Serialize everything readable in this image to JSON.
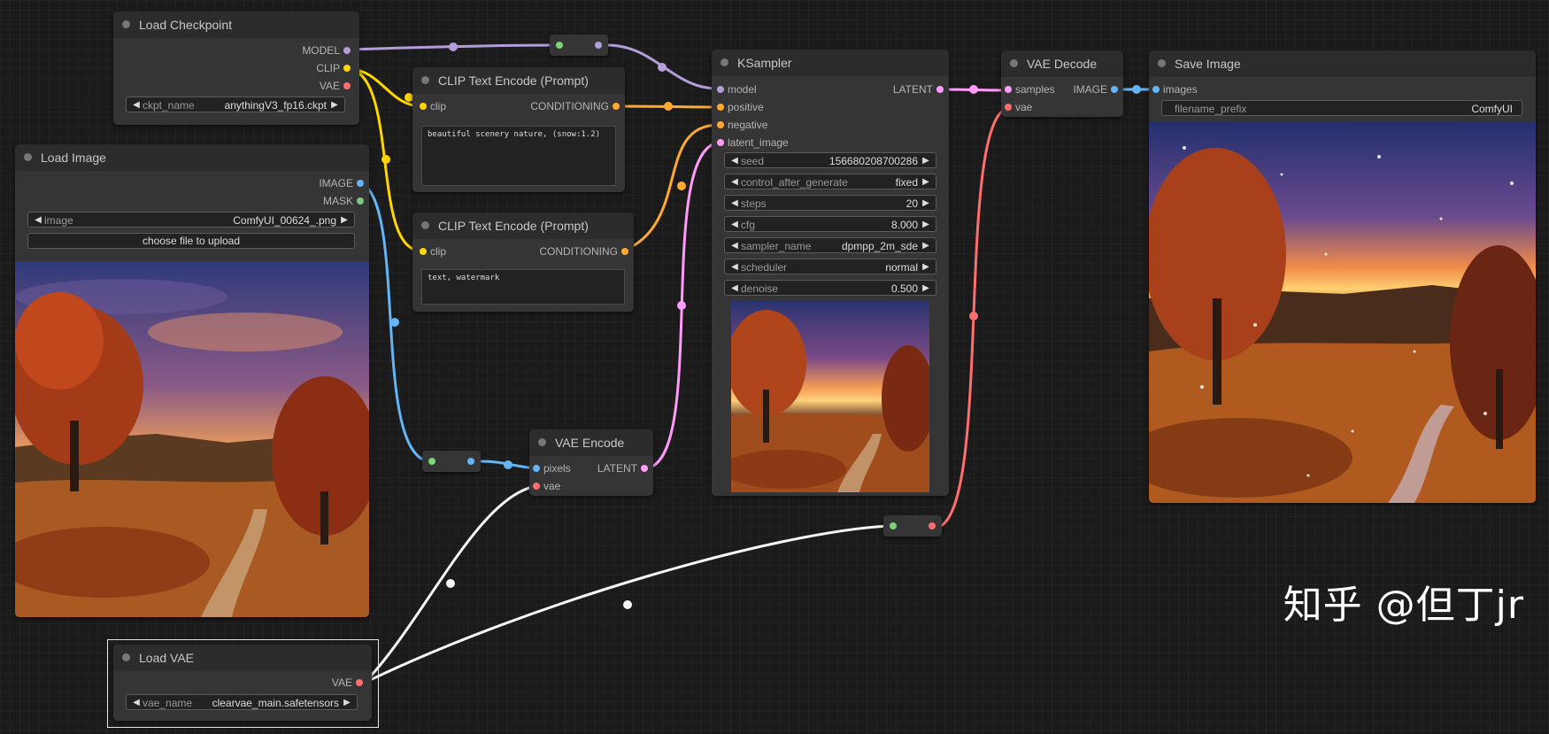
{
  "colors": {
    "model": "#b39ddb",
    "clip": "#ffd500",
    "vae": "#ff6e6e",
    "conditioning": "#ffa931",
    "latent": "#ff9cf9",
    "image": "#64b5f6",
    "mask": "#81c784",
    "vae_link": "#f5f5f5"
  },
  "nodes": {
    "load_checkpoint": {
      "title": "Load Checkpoint",
      "outputs": [
        "MODEL",
        "CLIP",
        "VAE"
      ],
      "widget": {
        "name": "ckpt_name",
        "value": "anythingV3_fp16.ckpt"
      }
    },
    "load_image": {
      "title": "Load Image",
      "outputs": [
        "IMAGE",
        "MASK"
      ],
      "widget": {
        "name": "image",
        "value": "ComfyUI_00624_.png"
      },
      "upload_button": "choose file to upload"
    },
    "clip_pos": {
      "title": "CLIP Text Encode (Prompt)",
      "input": "clip",
      "output": "CONDITIONING",
      "text": "beautiful scenery nature, (snow:1.2)"
    },
    "clip_neg": {
      "title": "CLIP Text Encode (Prompt)",
      "input": "clip",
      "output": "CONDITIONING",
      "text": "text, watermark"
    },
    "ksampler": {
      "title": "KSampler",
      "inputs": [
        "model",
        "positive",
        "negative",
        "latent_image"
      ],
      "output": "LATENT",
      "widgets": [
        {
          "name": "seed",
          "value": "156680208700286"
        },
        {
          "name": "control_after_generate",
          "value": "fixed"
        },
        {
          "name": "steps",
          "value": "20"
        },
        {
          "name": "cfg",
          "value": "8.000"
        },
        {
          "name": "sampler_name",
          "value": "dpmpp_2m_sde"
        },
        {
          "name": "scheduler",
          "value": "normal"
        },
        {
          "name": "denoise",
          "value": "0.500"
        }
      ]
    },
    "vae_decode": {
      "title": "VAE Decode",
      "inputs": [
        "samples",
        "vae"
      ],
      "output": "IMAGE"
    },
    "save_image": {
      "title": "Save Image",
      "input": "images",
      "widget": {
        "name": "filename_prefix",
        "value": "ComfyUI"
      }
    },
    "vae_encode": {
      "title": "VAE Encode",
      "inputs": [
        "pixels",
        "vae"
      ],
      "output": "LATENT"
    },
    "load_vae": {
      "title": "Load VAE",
      "output": "VAE",
      "widget": {
        "name": "vae_name",
        "value": "clearvae_main.safetensors"
      }
    }
  },
  "watermark": "知乎 @但丁jr",
  "icons": {
    "left_arrow": "◀",
    "right_arrow": "▶"
  }
}
